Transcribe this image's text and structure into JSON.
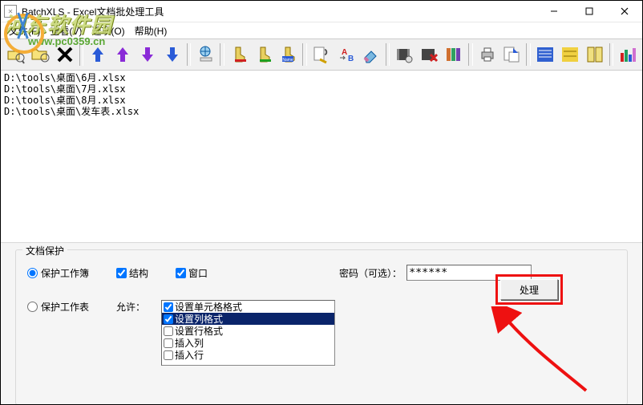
{
  "window": {
    "title": "BatchXLS - Excel文档批处理工具"
  },
  "menu": {
    "file": "文件(F)",
    "view": "查看(V)",
    "options": "选项(O)",
    "help": "帮助(H)"
  },
  "files": [
    "D:\\tools\\桌面\\6月.xlsx",
    "D:\\tools\\桌面\\7月.xlsx",
    "D:\\tools\\桌面\\8月.xlsx",
    "D:\\tools\\桌面\\发车表.xlsx"
  ],
  "panel": {
    "label": "文档保护",
    "protect_workbook": "保护工作簿",
    "protect_sheet": "保护工作表",
    "structure": "结构",
    "window": "窗口",
    "password_label": "密码（可选）：",
    "password_value": "******",
    "allow_label": "允许：",
    "allow_items": [
      {
        "label": "设置单元格格式",
        "checked": true,
        "selected": false
      },
      {
        "label": "设置列格式",
        "checked": true,
        "selected": true
      },
      {
        "label": "设置行格式",
        "checked": false,
        "selected": false
      },
      {
        "label": "插入列",
        "checked": false,
        "selected": false
      },
      {
        "label": "插入行",
        "checked": false,
        "selected": false
      }
    ],
    "process_button": "处理"
  },
  "watermark": {
    "line1": "河东软件园",
    "line2": "www.pc0359.cn"
  }
}
